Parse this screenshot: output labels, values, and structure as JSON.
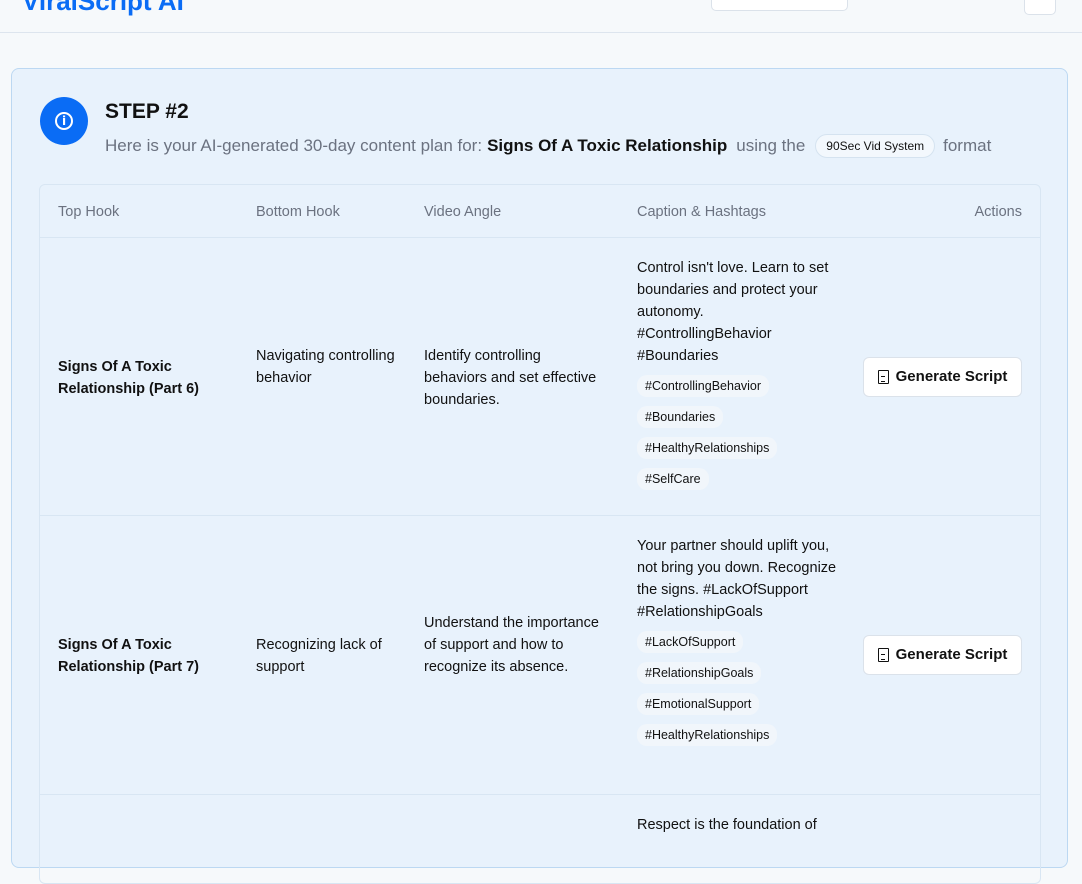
{
  "header": {
    "logo": "ViralScript AI"
  },
  "step": {
    "title": "STEP #2",
    "intro": "Here is your AI-generated 30-day content plan for:",
    "topic": "Signs Of A Toxic Relationship",
    "using": "using the",
    "format_name": "90Sec Vid System",
    "format_suffix": "format"
  },
  "table": {
    "headers": [
      "Top Hook",
      "Bottom Hook",
      "Video Angle",
      "Caption & Hashtags",
      "Actions"
    ],
    "action_label": "Generate Script",
    "rows": [
      {
        "top": "Signs Of A Toxic Relationship (Part 6)",
        "bottom": "Navigating controlling behavior",
        "angle": "Identify controlling behaviors and set effective boundaries.",
        "caption": "Control isn't love. Learn to set boundaries and protect your autonomy. #ControllingBehavior #Boundaries",
        "tags": [
          "#ControllingBehavior",
          "#Boundaries",
          "#HealthyRelationships",
          "#SelfCare"
        ]
      },
      {
        "top": "Signs Of A Toxic Relationship (Part 7)",
        "bottom": "Recognizing lack of support",
        "angle": "Understand the importance of support and how to recognize its absence.",
        "caption": "Your partner should uplift you, not bring you down. Recognize the signs. #LackOfSupport #RelationshipGoals",
        "tags": [
          "#LackOfSupport",
          "#RelationshipGoals",
          "#EmotionalSupport",
          "#HealthyRelationships"
        ]
      },
      {
        "caption": "Respect is the foundation of"
      }
    ]
  }
}
